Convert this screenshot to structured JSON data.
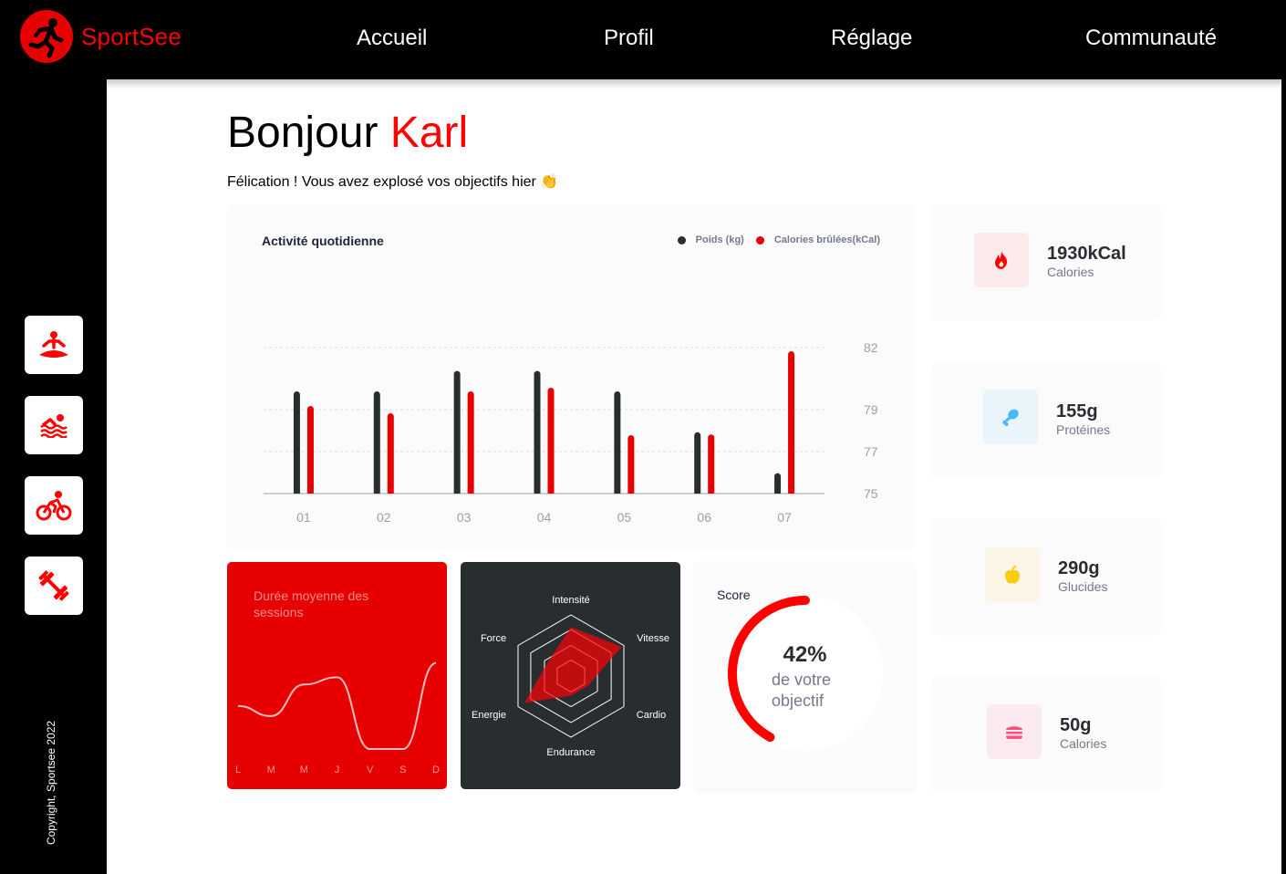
{
  "app": {
    "name": "SportSee"
  },
  "nav": {
    "items": [
      "Accueil",
      "Profil",
      "Réglage",
      "Communauté"
    ]
  },
  "sidebar": {
    "icons": [
      "yoga-icon",
      "swimming-icon",
      "cycling-icon",
      "dumbbell-icon"
    ],
    "copyright": "Copyright, Sportsee 2022"
  },
  "greeting": {
    "prefix": "Bonjour",
    "name": "Karl",
    "message": "Félication ! Vous avez explosé vos objectifs hier 👏"
  },
  "colors": {
    "accent": "#ff0101",
    "dark": "#282d30",
    "sessions_bg": "#e60000"
  },
  "activity": {
    "title": "Activité quotidienne",
    "legend_weight": "Poids (kg)",
    "legend_calories": "Calories brûlées(kCal)"
  },
  "sessions": {
    "title": "Durée moyenne des sessions"
  },
  "performance": {
    "labels": [
      "Intensité",
      "Vitesse",
      "Cardio",
      "Endurance",
      "Energie",
      "Force"
    ]
  },
  "score": {
    "title": "Score",
    "percent": "42%",
    "subtitle": "de votre objectif",
    "value": 0.42
  },
  "key_data": [
    {
      "value": "1930kCal",
      "label": "Calories",
      "icon": "fire-icon",
      "bg": "#fbeaea",
      "color": "#ff0000"
    },
    {
      "value": "155g",
      "label": "Protéines",
      "icon": "chicken-icon",
      "bg": "#e9f4fb",
      "color": "#4ab8ff"
    },
    {
      "value": "290g",
      "label": "Glucides",
      "icon": "apple-icon",
      "bg": "#fbf6e5",
      "color": "#fdcc0c"
    },
    {
      "value": "50g",
      "label": "Calories",
      "icon": "burger-icon",
      "bg": "#fbeaef",
      "color": "#fd5181"
    }
  ],
  "chart_data": [
    {
      "type": "bar",
      "title": "Activité quotidienne",
      "categories": [
        "01",
        "02",
        "03",
        "04",
        "05",
        "06",
        "07"
      ],
      "y_ticks": [
        "82",
        "79",
        "77",
        "75"
      ],
      "series": [
        {
          "name": "Poids (kg)",
          "color": "#282d30",
          "values": [
            80,
            80,
            81,
            81,
            80,
            78,
            76
          ]
        },
        {
          "name": "Calories brûlées(kCal)",
          "color": "#e60000",
          "values": [
            240,
            220,
            280,
            290,
            160,
            162,
            390
          ]
        }
      ],
      "ylim_weight": [
        75,
        82
      ],
      "ylim_calories": [
        0,
        400
      ],
      "legend_position": "top-right"
    },
    {
      "type": "line",
      "title": "Durée moyenne des sessions",
      "categories": [
        "L",
        "M",
        "M",
        "J",
        "V",
        "S",
        "D"
      ],
      "series": [
        {
          "values": [
            30,
            23,
            45,
            50,
            0,
            0,
            60
          ]
        }
      ],
      "ylim": [
        0,
        70
      ]
    },
    {
      "type": "radar",
      "categories": [
        "Intensité",
        "Vitesse",
        "Cardio",
        "Endurance",
        "Energie",
        "Force"
      ],
      "series": [
        {
          "values": [
            200,
            240,
            80,
            80,
            220,
            110
          ]
        }
      ],
      "max": 250
    }
  ]
}
